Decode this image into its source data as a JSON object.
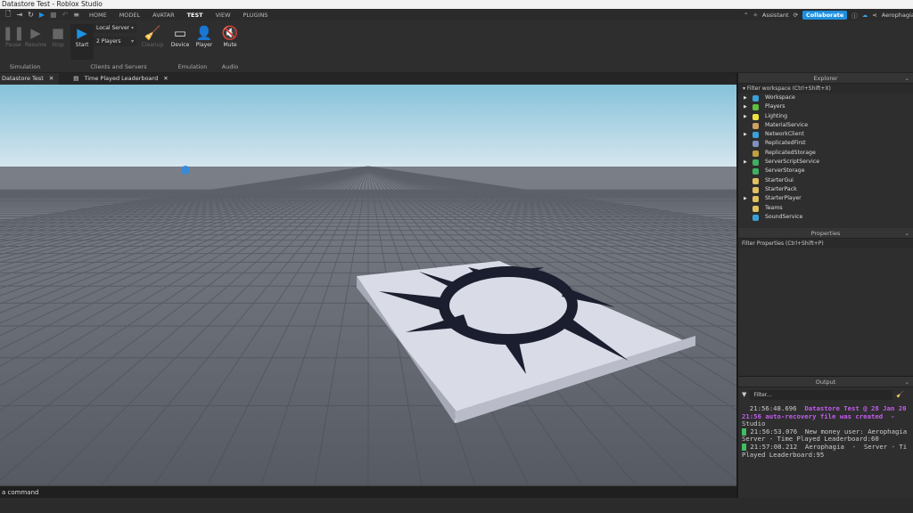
{
  "window": {
    "title": "Datastore Test - Roblox Studio"
  },
  "menu": {
    "tabs": [
      "HOME",
      "MODEL",
      "AVATAR",
      "TEST",
      "VIEW",
      "PLUGINS"
    ],
    "active": "TEST",
    "right": {
      "assistant": "Assistant",
      "collaborate": "Collaborate",
      "user": "Aerophagia"
    }
  },
  "ribbon": {
    "simulation": {
      "pause": "Pause",
      "resume": "Resume",
      "stop": "Stop",
      "label": "Simulation"
    },
    "clients": {
      "start": "Start",
      "server_select": "Local Server",
      "players_select": "2 Players",
      "cleanup": "Cleanup",
      "label": "Clients and Servers"
    },
    "emulation": {
      "device": "Device",
      "player": "Player",
      "label": "Emulation"
    },
    "audio": {
      "mute": "Mute",
      "label": "Audio"
    }
  },
  "doc_tabs": [
    {
      "label": "Datastore Test"
    },
    {
      "label": "Time Played Leaderboard"
    }
  ],
  "explorer": {
    "title": "Explorer",
    "filter": "Filter workspace (Ctrl+Shift+X)",
    "items": [
      {
        "label": "Workspace",
        "expandable": true,
        "color": "#3aa0d8"
      },
      {
        "label": "Players",
        "expandable": true,
        "color": "#5fbf3f"
      },
      {
        "label": "Lighting",
        "expandable": true,
        "color": "#f0e040"
      },
      {
        "label": "MaterialService",
        "expandable": false,
        "color": "#d0a060"
      },
      {
        "label": "NetworkClient",
        "expandable": true,
        "color": "#3aa0d8"
      },
      {
        "label": "ReplicatedFirst",
        "expandable": false,
        "color": "#8090c0"
      },
      {
        "label": "ReplicatedStorage",
        "expandable": false,
        "color": "#c0a040"
      },
      {
        "label": "ServerScriptService",
        "expandable": true,
        "color": "#40b060"
      },
      {
        "label": "ServerStorage",
        "expandable": false,
        "color": "#40b060"
      },
      {
        "label": "StarterGui",
        "expandable": false,
        "color": "#e0c060"
      },
      {
        "label": "StarterPack",
        "expandable": false,
        "color": "#e0c060"
      },
      {
        "label": "StarterPlayer",
        "expandable": true,
        "color": "#e0c060"
      },
      {
        "label": "Teams",
        "expandable": false,
        "color": "#e0c060"
      },
      {
        "label": "SoundService",
        "expandable": false,
        "color": "#3aa0d8"
      }
    ]
  },
  "properties": {
    "title": "Properties",
    "filter": "Filter Properties (Ctrl+Shift+P)"
  },
  "output": {
    "title": "Output",
    "filter_placeholder": "Filter...",
    "lines": [
      {
        "time": "21:56:48.696",
        "text": "Datastore Test @ 28 Jan 20",
        "cont": "21:56 auto-recovery file was created  -",
        "cont2": "Studio"
      },
      {
        "time": "21:56:53.076",
        "text": "New money user: Aerophagia",
        "cont": "Server - Time Played Leaderboard:60"
      },
      {
        "time": "21:57:08.212",
        "text": "Aerophagia  -  Server - Ti",
        "cont": "Played Leaderboard:95"
      }
    ]
  },
  "command_bar": {
    "placeholder": "a command"
  },
  "colors": {
    "accent": "#1e90e0",
    "output_purple": "#c45cf0",
    "sky_top": "#8cc4dc",
    "ground": "#5d6068"
  }
}
